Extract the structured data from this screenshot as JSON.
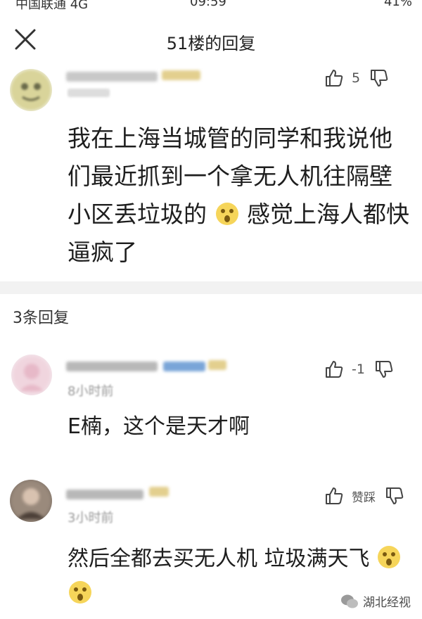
{
  "status_bar": {
    "carrier": "中国联通 4G",
    "time": "09:59",
    "battery": "41%"
  },
  "header": {
    "title": "51楼的回复"
  },
  "main_comment": {
    "likes": "5",
    "text_before_emoji": "我在上海当城管的同学和我说他们最近抓到一个拿无人机往隔壁小区丢垃圾的",
    "text_after_emoji": "感觉上海人都快逼疯了"
  },
  "replies_header": {
    "count_label": "3条回复"
  },
  "replies": [
    {
      "time": "8小时前",
      "likes": "1",
      "text": "E楠，这个是天才啊"
    },
    {
      "time": "3小时前",
      "likes": "赞踩",
      "text": "然后全都去买无人机 垃圾满天飞"
    }
  ],
  "watermark": {
    "label": "湖北经视"
  },
  "colors": {
    "text": "#1e1e1e",
    "muted": "#555555",
    "divider": "#f2f2f2"
  }
}
